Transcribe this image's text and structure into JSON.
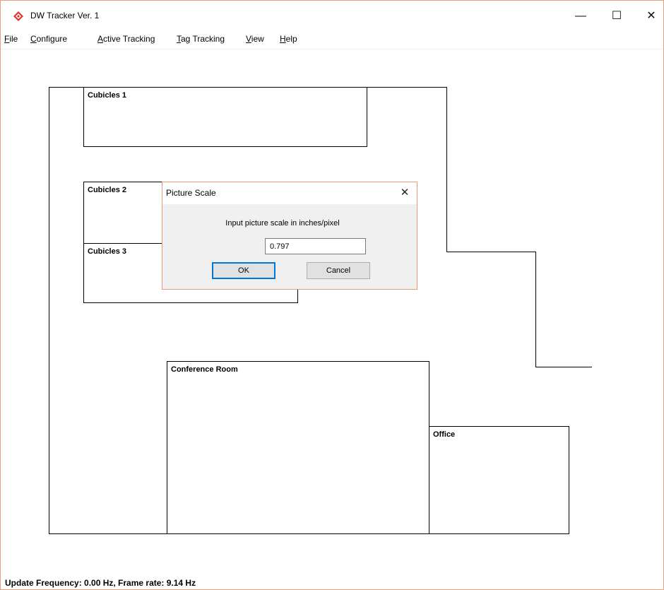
{
  "window": {
    "title": "DW Tracker Ver. 1",
    "minimize_glyph": "—",
    "maximize_glyph": "☐",
    "close_glyph": "✕",
    "border_color": "#e8a27a"
  },
  "menu": {
    "items": [
      {
        "label": "File",
        "mnemonic": "F"
      },
      {
        "label": "Configure",
        "mnemonic": "C"
      },
      {
        "label": "Active Tracking",
        "mnemonic": "A"
      },
      {
        "label": "Tag Tracking",
        "mnemonic": "T"
      },
      {
        "label": "View",
        "mnemonic": "V"
      },
      {
        "label": "Help",
        "mnemonic": "H"
      }
    ]
  },
  "floorplan": {
    "rooms": [
      {
        "name": "Cubicles 1"
      },
      {
        "name": "Cubicles 2"
      },
      {
        "name": "Cubicles 3"
      },
      {
        "name": "Conference Room"
      },
      {
        "name": "Office"
      }
    ]
  },
  "dialog": {
    "title": "Picture Scale",
    "prompt": "Input picture scale in inches/pixel",
    "input_value": "0.797",
    "ok_label": "OK",
    "cancel_label": "Cancel",
    "close_glyph": "✕",
    "accent_color": "#0078d7"
  },
  "status": {
    "text": "Update Frequency: 0.00 Hz, Frame rate: 9.14 Hz"
  },
  "icons": {
    "app_icon": "red-diamond-icon"
  }
}
